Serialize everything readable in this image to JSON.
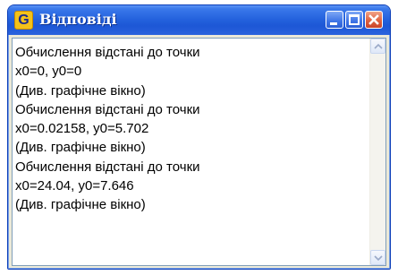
{
  "window": {
    "title": "Відповіді",
    "app_icon_letter": "G"
  },
  "output": {
    "lines": [
      "Обчислення відстані до точки",
      "x0=0, y0=0",
      "(Див. графічне вікно)",
      "Обчислення відстані до точки",
      "x0=0.02158, y0=5.702",
      "(Див. графічне вікно)",
      "Обчислення відстані до точки",
      "x0=24.04, y0=7.646",
      "(Див. графічне вікно)"
    ]
  },
  "colors": {
    "titlebar": "#2563de",
    "close_button": "#e0623e",
    "app_icon": "#f3c21a"
  },
  "icons": {
    "app": "app-g-icon",
    "minimize": "minimize-icon",
    "maximize": "maximize-icon",
    "close": "close-icon",
    "scroll_up": "chevron-up-icon",
    "scroll_down": "chevron-down-icon"
  }
}
